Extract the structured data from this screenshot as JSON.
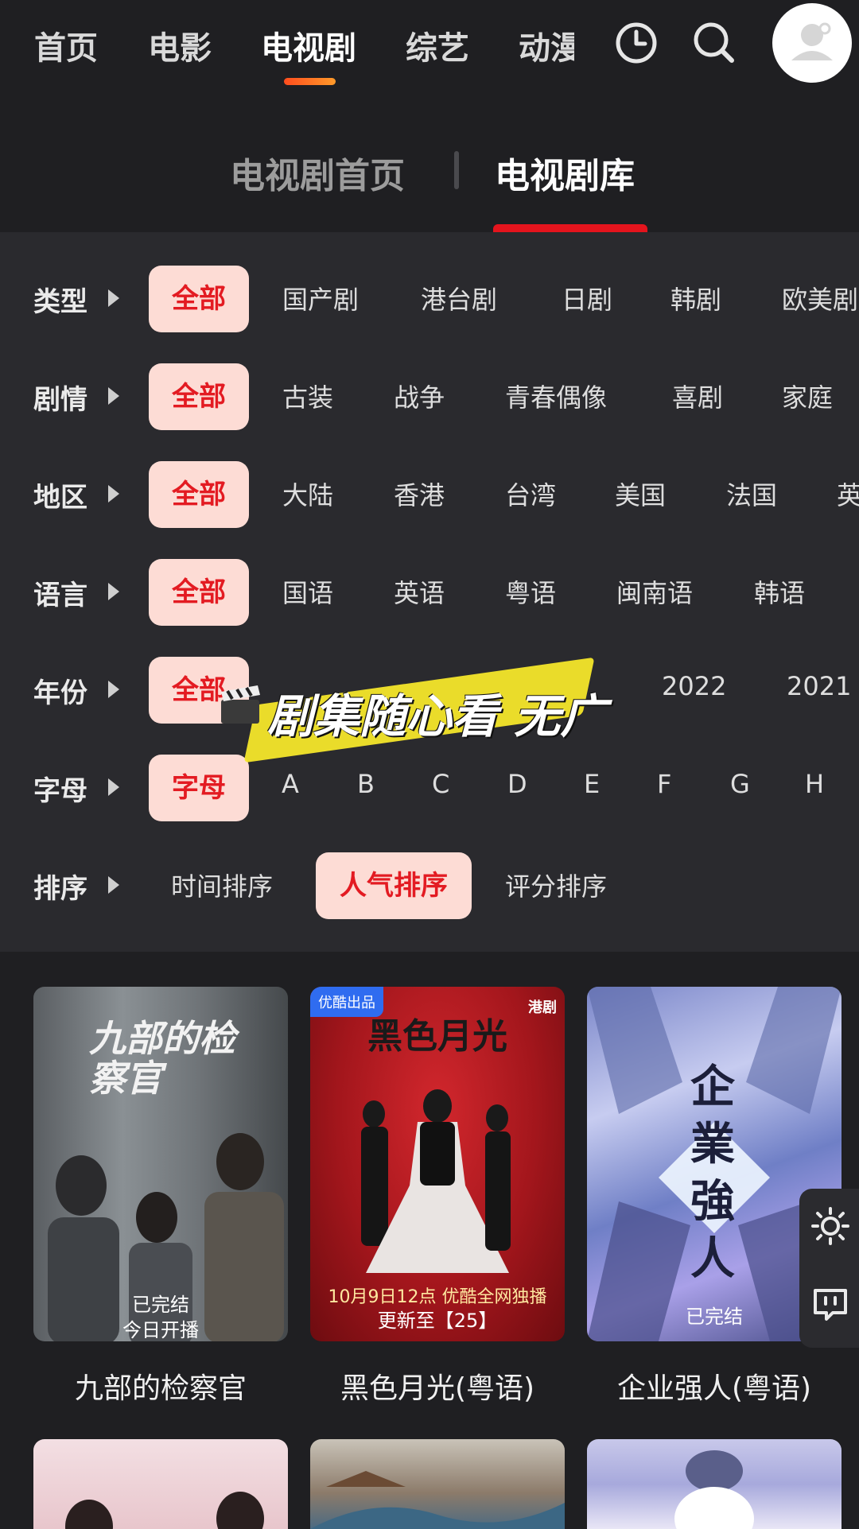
{
  "nav": {
    "items": [
      "首页",
      "电影",
      "电视剧",
      "综艺",
      "动漫"
    ],
    "active_index": 2
  },
  "subtabs": {
    "home": "电视剧首页",
    "library": "电视剧库",
    "active": "library"
  },
  "filters": {
    "type": {
      "label": "类型",
      "options": [
        "全部",
        "国产剧",
        "港台剧",
        "日剧",
        "韩剧",
        "欧美剧"
      ]
    },
    "plot": {
      "label": "剧情",
      "options": [
        "全部",
        "古装",
        "战争",
        "青春偶像",
        "喜剧",
        "家庭"
      ]
    },
    "region": {
      "label": "地区",
      "options": [
        "全部",
        "大陆",
        "香港",
        "台湾",
        "美国",
        "法国",
        "英"
      ]
    },
    "language": {
      "label": "语言",
      "options": [
        "全部",
        "国语",
        "英语",
        "粤语",
        "闽南语",
        "韩语"
      ]
    },
    "year": {
      "label": "年份",
      "options": [
        "全部",
        "2022",
        "2021"
      ]
    },
    "letter": {
      "label": "字母",
      "options": [
        "字母",
        "A",
        "B",
        "C",
        "D",
        "E",
        "F",
        "G",
        "H"
      ]
    },
    "sort": {
      "label": "排序",
      "options": [
        "时间排序",
        "人气排序",
        "评分排序"
      ],
      "active_index": 1
    }
  },
  "overlay": {
    "text": "剧集随心看 无广"
  },
  "cards": [
    {
      "title": "九部的检察官",
      "status1": "已完结",
      "status2": "今日开播",
      "poster_text": "九部的检察官"
    },
    {
      "title": "黑色月光(粤语)",
      "status1": "更新至【25】",
      "poster_text": "黑色月光",
      "brand": "优酷出品",
      "tag": "港剧",
      "promo": "10月9日12点 优酷全网独播"
    },
    {
      "title": "企业强人(粤语)",
      "status1": "已完结",
      "poster_text": "企業強人"
    }
  ],
  "colors": {
    "accent": "#e4141d",
    "chip_bg": "#fddcd5",
    "chip_text": "#e31b22",
    "nav_indicator": "#ff6a22"
  }
}
